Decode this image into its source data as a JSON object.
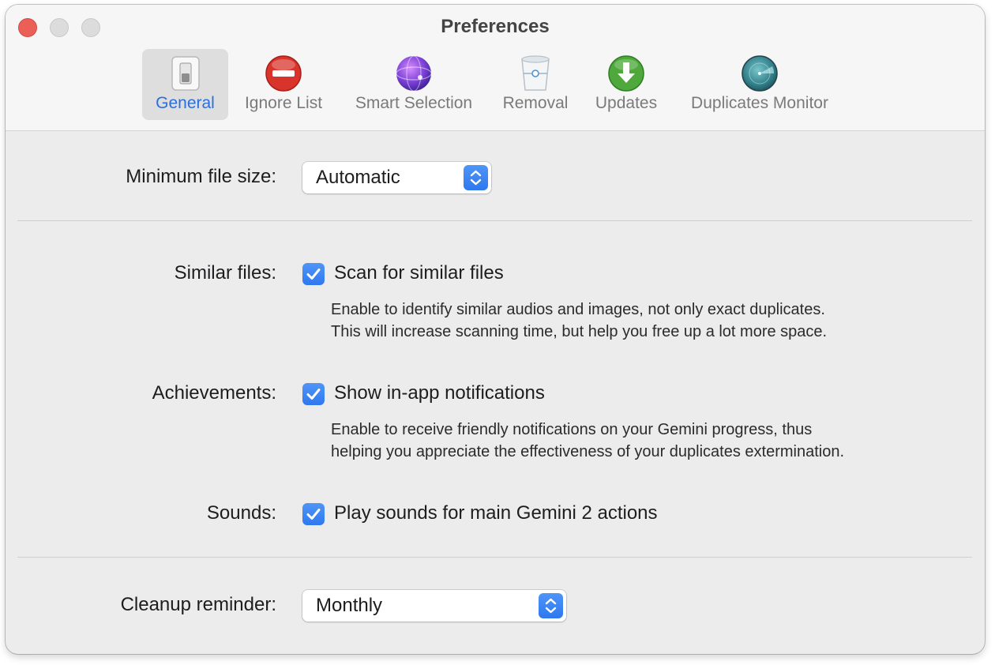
{
  "window": {
    "title": "Preferences"
  },
  "toolbar": {
    "tabs": [
      {
        "label": "General",
        "icon": "switch-icon",
        "active": true
      },
      {
        "label": "Ignore List",
        "icon": "no-entry-icon",
        "active": false
      },
      {
        "label": "Smart Selection",
        "icon": "sphere-icon",
        "active": false
      },
      {
        "label": "Removal",
        "icon": "trash-bin-icon",
        "active": false
      },
      {
        "label": "Updates",
        "icon": "download-arrow-icon",
        "active": false
      },
      {
        "label": "Duplicates Monitor",
        "icon": "radar-icon",
        "active": false
      }
    ]
  },
  "settings": {
    "min_file_size": {
      "label": "Minimum file size:",
      "value": "Automatic"
    },
    "similar_files": {
      "label": "Similar files:",
      "checkbox_label": "Scan for similar files",
      "checked": true,
      "description_line1": "Enable to identify similar audios and images, not only exact duplicates.",
      "description_line2": "This will increase scanning time, but help you free up a lot more space."
    },
    "achievements": {
      "label": "Achievements:",
      "checkbox_label": "Show in-app notifications",
      "checked": true,
      "description_line1": "Enable to receive friendly notifications on your Gemini progress, thus",
      "description_line2": "helping you appreciate the effectiveness of your duplicates extermination."
    },
    "sounds": {
      "label": "Sounds:",
      "checkbox_label": "Play sounds for main Gemini 2 actions",
      "checked": true
    },
    "cleanup_reminder": {
      "label": "Cleanup reminder:",
      "value": "Monthly"
    }
  },
  "colors": {
    "accent": "#2f78ee",
    "active_tab_text": "#2a6fdb",
    "close": "#ec5f57"
  }
}
